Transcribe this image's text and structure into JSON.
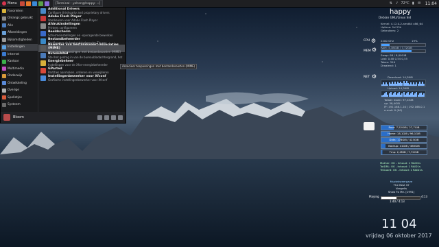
{
  "panel": {
    "menu_label": "Menu",
    "task_title": "[Terminal : yohan@happy: ~]",
    "temp": "72°C",
    "clock": "11:04"
  },
  "menu": {
    "categories": [
      {
        "label": "Favorieten",
        "color": "#d9b33a"
      },
      {
        "label": "Onlangs gebruikt",
        "color": "#8c8c8c"
      },
      {
        "label": "Alle",
        "color": "#4d7fc0"
      },
      {
        "label": "Afbeeldingen",
        "color": "#6aa0d8"
      },
      {
        "label": "Bijkomstigheden",
        "color": "#9a9a9a"
      },
      {
        "label": "Instellingen",
        "color": "#5aa0e0"
      },
      {
        "label": "Internet",
        "color": "#3a7ad0"
      },
      {
        "label": "Kantoor",
        "color": "#3ab04a"
      },
      {
        "label": "Multimedia",
        "color": "#c24fc2"
      },
      {
        "label": "Onderwijs",
        "color": "#d89a3a"
      },
      {
        "label": "Ontwikkeling",
        "color": "#5a8ad8"
      },
      {
        "label": "Overige",
        "color": "#b0b0b0"
      },
      {
        "label": "Spelletjes",
        "color": "#d85a3a"
      },
      {
        "label": "Systeem",
        "color": "#6a6a6a"
      }
    ],
    "apps": [
      {
        "title": "Additional Drivers",
        "desc": "Configure third-party and proprietary drivers",
        "color": "#4a8ac8"
      },
      {
        "title": "Adobe Flash Player",
        "desc": "Voorkeuren voor Adobe Flash Player",
        "color": "#c83a3a"
      },
      {
        "title": "Afdrukinstellingen",
        "desc": "Printers configureren",
        "color": "#8a8a8a"
      },
      {
        "title": "Beeldscherm",
        "desc": "Schermeinstellingen en -opvragende bewerken",
        "color": "#3a6ac8"
      },
      {
        "title": "Bestandbeheerder",
        "desc": "Configureer de bestandsbeheerder Thunar",
        "color": "#3a8ac8"
      },
      {
        "title": "Bewerker van bestandssoort-associaties (MIME)",
        "desc": "Associeer toepassingen met bestandssoorten (MIME)",
        "color": "#5a5a5a"
      },
      {
        "title": "Bureaublad",
        "desc": "Stel het gedrag in van de bureaubladachtergrond, het",
        "color": "#4a7ab8"
      },
      {
        "title": "Energiebeheer",
        "desc": "Instellingen voor de Xfce-energiebeheerder",
        "color": "#d8b03a"
      },
      {
        "title": "GParted",
        "desc": "Partities aanmaken, ordenen en verwijderen",
        "color": "#d84a3a"
      },
      {
        "title": "Instellingenbewerker voor Xfconf",
        "desc": "Grafische instellingenbewerker voor Xfconf",
        "color": "#4a8ad8"
      }
    ],
    "tooltip": "Associeer toepassingen met bestandssoorten (MIME)",
    "user": "Bloom"
  },
  "desktop_icons": [],
  "conky": {
    "title": "happy",
    "subtitle": "Debian GNU/Linux Sid",
    "sys_lines": [
      "Kernel: 4.12.0-2-amd64 x86_64",
      "Uptime: 2d 23h",
      "Gebruikers: 2"
    ],
    "cpu_label": "CPU",
    "cpu_freq": "2200 GHz",
    "cpu_pct": "19%",
    "cpu_value": 19,
    "mem_label": "MEM",
    "ram_text": "RAM: 5,38GiB / 7,72GiB",
    "ram_value": 69,
    "mem_lines": [
      "Swap: 0B / 8,00GiB",
      "Lost: 0,48 0,54 0,55",
      "Taken: 310",
      "Draaiend: 1"
    ],
    "net_label": "NET",
    "download": "Download: 14,5KiB",
    "upload": "Upload: 14,5KiB",
    "net_lines": [
      "Totaal: down: 97,4GiB",
      "up: 38,4GiB",
      "IP: 192.168.1.10 | 192.168.0.1",
      "e-mail: 0 (00)"
    ],
    "disks": [
      {
        "text": "Root: 7,52GiB / 27,7GiB",
        "value": 27
      },
      {
        "text": "Home: 18,1GiB / 96,1GiB",
        "value": 19
      },
      {
        "text": "Data: 178GiB / 423GiB",
        "value": 42
      },
      {
        "text": "Backup: 41GiB / 460GiB",
        "value": 9
      },
      {
        "text": "Tmp: 2,4MiB / 7,72GiB",
        "value": 2
      }
    ],
    "disk_health": [
      "Mother: OK - Inhoud: 1 RAID1s",
      "TotDRL: OK - Inhoud: 1 RAID1s",
      "TriGuard: OK - Inhoud: 1 RAID1s"
    ],
    "music_heading": "Muziekweergave",
    "music_lines": [
      "The Best Of",
      "Vangelis",
      "Show Fo Me. [1991]"
    ],
    "playing_label": "Playing",
    "play_time": "4:13",
    "play_position": "1:40 / 4:13",
    "play_value": 40
  },
  "big_clock": {
    "time": "11 04",
    "date": "vrijdag 06 oktober 2017"
  }
}
